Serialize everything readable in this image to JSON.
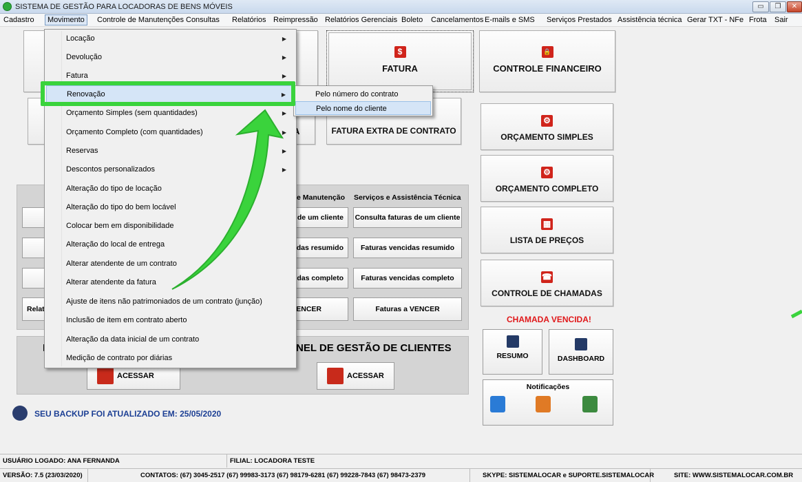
{
  "window": {
    "title": "SISTEMA DE GESTÃO PARA LOCADORAS DE BENS MÓVEIS",
    "minimize_glyph": "▭",
    "maximize_glyph": "❐",
    "close_glyph": "✕"
  },
  "menubar": [
    "Cadastro",
    "Movimento",
    "Controle de Manutenções",
    "Consultas",
    "Relatórios",
    "Reimpressão",
    "Relatórios Gerenciais",
    "Boleto",
    "Cancelamentos",
    "E-mails e SMS",
    "Serviços Prestados",
    "Assistência técnica",
    "Gerar TXT - NFe",
    "Frota",
    "Sair"
  ],
  "movimento_menu": [
    "Locação",
    "Devolução",
    "Fatura",
    "Renovação",
    "Orçamento Simples (sem quantidades)",
    "Orçamento Completo (com quantidades)",
    "Reservas",
    "Descontos personalizados",
    "Alteração do tipo de locação",
    "Alteração do tipo do bem locável",
    "Colocar bem em disponibilidade",
    "Alteração do local de entrega",
    "Alterar atendente de um contrato",
    "Alterar atendente da fatura",
    "Ajuste de itens não patrimoniados de um contrato (junção)",
    "Inclusão de item em contrato aberto",
    "Alteração da data inicial de um contrato",
    "Medição de contrato por diárias"
  ],
  "submenu_arrow": "▶",
  "renovacao_submenu": [
    "Pelo número do contrato",
    "Pelo nome do cliente"
  ],
  "tiles": {
    "fatura": "FATURA",
    "fatura_icon": "$",
    "controle_financeiro": "CONTROLE FINANCEIRO",
    "controle_financeiro_icon": "🔒",
    "fatura_extra": "FATURA EXTRA DE CONTRATO",
    "partial_a": "A",
    "orcamento_simples": "ORÇAMENTO SIMPLES",
    "orcamento_completo": "ORÇAMENTO COMPLETO",
    "gear_icon": "⚙",
    "lista_precos": "LISTA DE PREÇOS",
    "lista_icon": "▦",
    "controle_chamadas": "CONTROLE DE CHAMADAS",
    "phone_icon": "☎"
  },
  "panel": {
    "col_manutencao": "e Manutenção",
    "col_servicos": "Serviços e Assistência Técnica",
    "left_partial_1": "s de um cliente",
    "left_partial_2": "das resumido",
    "left_partial_3": "das completo",
    "left_partial_4": "VENCER",
    "right_1": "Consulta faturas de um cliente",
    "right_2": "Faturas vencidas resumido",
    "right_3": "Faturas vencidas completo",
    "right_4": "Faturas a VENCER",
    "relat_partial": "Relat"
  },
  "painel_clientes": {
    "title_partial": "NEL DE GESTÃO DE CLIENTES",
    "left_letter": "F",
    "acessar": "ACESSAR"
  },
  "chamada_vencida": "CHAMADA VENCIDA!",
  "small_buttons": {
    "resumo": "RESUMO",
    "dashboard": "DASHBOARD"
  },
  "notificacoes": "Notificações",
  "backup_text": "SEU BACKUP FOI ATUALIZADO EM: 25/05/2020",
  "status1": {
    "usuario": "USUÁRIO LOGADO: ANA FERNANDA",
    "filial": "FILIAL: LOCADORA TESTE"
  },
  "status2": {
    "versao": "VERSÃO: 7.5 (23/03/2020)",
    "contatos": "CONTATOS: (67) 3045-2517  (67) 99983-3173  (67) 98179-6281  (67) 99228-7843  (67) 98473-2379",
    "skype": "SKYPE: SISTEMALOCAR e SUPORTE.SISTEMALOCAR",
    "site": "SITE: WWW.SISTEMALOCAR.COM.BR"
  },
  "colors": {
    "accent_red": "#d0241b",
    "highlight_green": "#3ad33c",
    "menu_hover": "#d5e5f7",
    "backup_blue": "#1c3f94"
  }
}
